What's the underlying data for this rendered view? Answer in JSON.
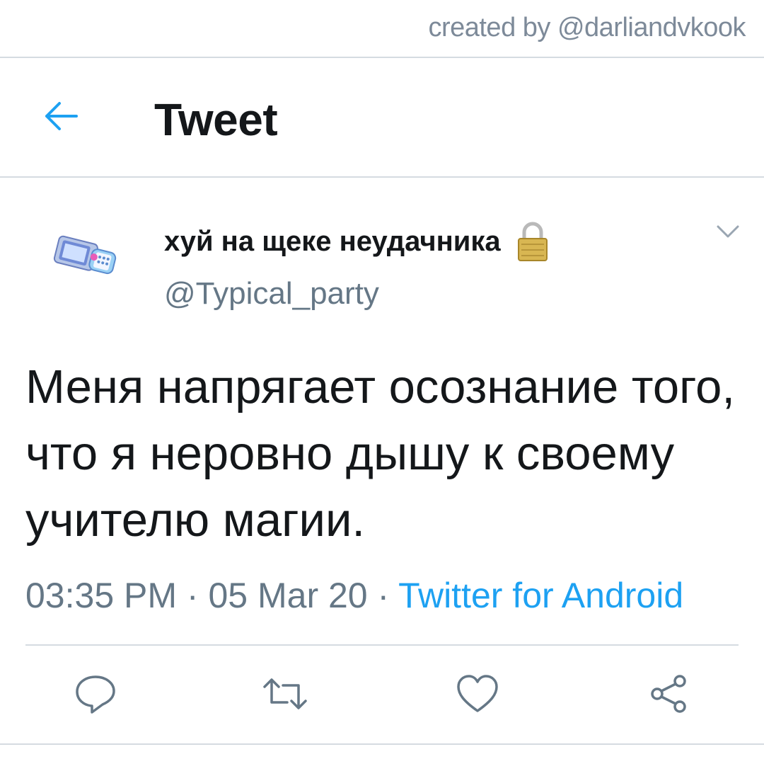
{
  "watermark": "created by @darliandvkook",
  "header": {
    "title": "Tweet",
    "back_icon": "arrow-left-icon"
  },
  "tweet": {
    "author_name": "хуй на щеке неудачника",
    "author_handle": "@Typical_party",
    "lock_icon": "lock-icon",
    "avatar_icon": "flip-phone-avatar",
    "text": "Меня напрягает осознание того, что я неровно дышу к своему учителю магии.",
    "time": "03:35 PM",
    "separator": "·",
    "date": "05 Mar 20",
    "source": "Twitter for Android"
  },
  "actions": [
    {
      "name": "reply-icon"
    },
    {
      "name": "retweet-icon"
    },
    {
      "name": "like-icon"
    },
    {
      "name": "share-icon"
    }
  ],
  "colors": {
    "accent": "#1da1f2",
    "secondary_text": "#657786",
    "divider": "#d5dbe1"
  }
}
